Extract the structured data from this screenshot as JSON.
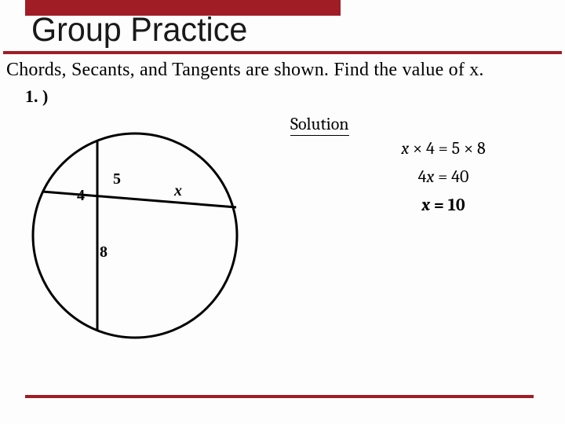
{
  "header": {
    "title": "Group Practice"
  },
  "subtitle": "Chords, Secants, and Tangents are shown. Find the value of x.",
  "problem": {
    "number": "1. )",
    "figure": {
      "segments": {
        "a": "4",
        "b": "5",
        "c": "8",
        "d": "x"
      }
    }
  },
  "solution": {
    "label": "Solution",
    "line1_lhs_var": "x",
    "line1_lhs_op": " × 4 = 5 × 8",
    "line2_lhs": "4",
    "line2_var": "x",
    "line2_rhs": " = 40",
    "answer_var": "x",
    "answer_rhs": " = 10"
  },
  "chart_data": {
    "type": "diagram",
    "description": "Two intersecting chords in a circle",
    "segments": [
      {
        "name": "left-of-intersection",
        "length": 4
      },
      {
        "name": "right-upper",
        "length": 5
      },
      {
        "name": "below-intersection",
        "length": 8
      },
      {
        "name": "right-of-intersection",
        "length": "x"
      }
    ],
    "relation": "x * 4 = 5 * 8",
    "answer": 10
  }
}
